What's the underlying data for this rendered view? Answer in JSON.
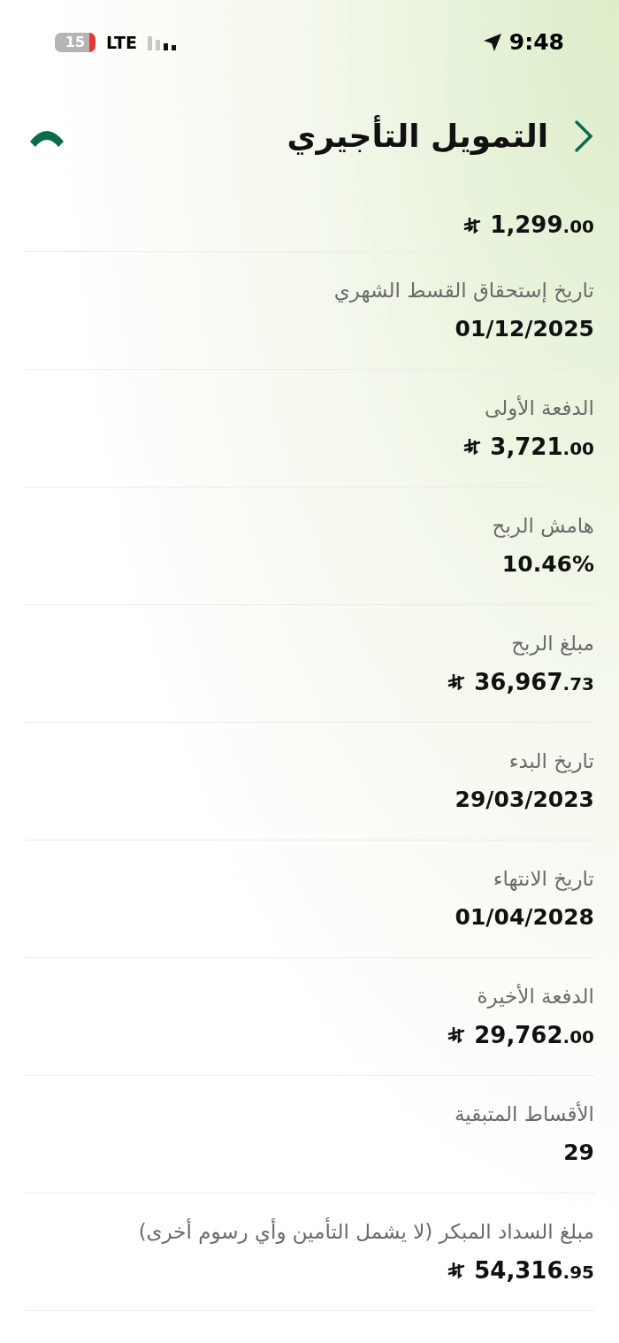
{
  "status_bar": {
    "battery": "15",
    "network": "LTE",
    "time": "9:48"
  },
  "header": {
    "title": "التمويل التأجيري"
  },
  "rows": [
    {
      "kind": "money",
      "value": "1,299.00"
    },
    {
      "kind": "text",
      "label": "تاريخ إستحقاق القسط الشهري",
      "value": "01/12/2025"
    },
    {
      "kind": "money",
      "label": "الدفعة الأولى",
      "value": "3,721.00"
    },
    {
      "kind": "text",
      "label": "هامش الربح",
      "value": "10.46%"
    },
    {
      "kind": "money",
      "label": "مبلغ الربح",
      "value": "36,967.73"
    },
    {
      "kind": "text",
      "label": "تاريخ البدء",
      "value": "29/03/2023"
    },
    {
      "kind": "text",
      "label": "تاريخ الانتهاء",
      "value": "01/04/2028"
    },
    {
      "kind": "money",
      "label": "الدفعة الأخيرة",
      "value": "29,762.00"
    },
    {
      "kind": "text",
      "label": "الأقساط المتبقية",
      "value": "29"
    },
    {
      "kind": "money",
      "label": "مبلغ السداد المبكر (لا يشمل التأمين وأي رسوم أخرى)",
      "value": "54,316.95"
    }
  ]
}
